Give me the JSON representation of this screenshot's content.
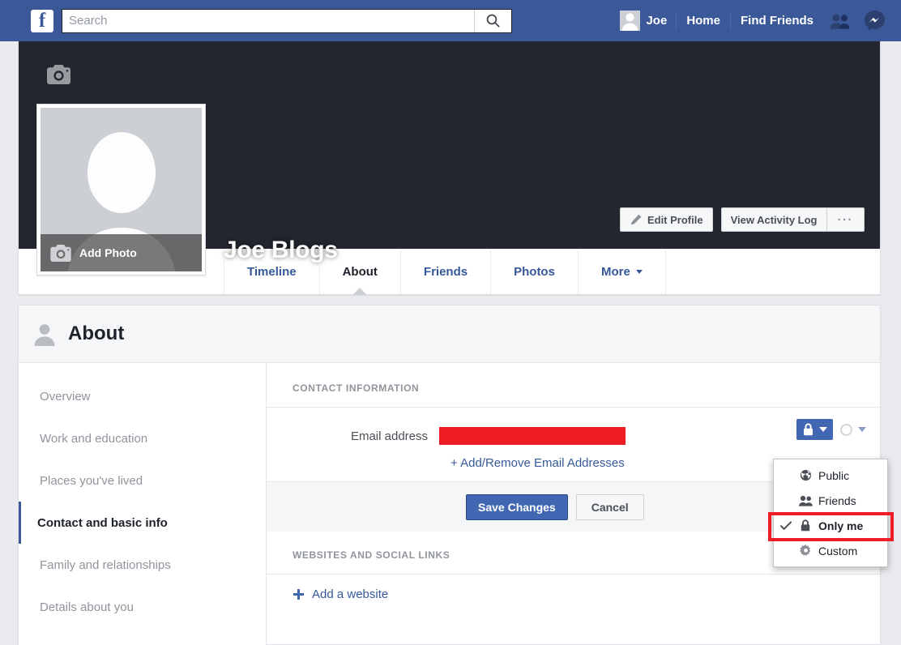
{
  "topnav": {
    "logo_letter": "f",
    "search": {
      "placeholder": "Search",
      "value": ""
    },
    "search_icon": "search-icon",
    "user_name": "Joe",
    "home_label": "Home",
    "find_friends_label": "Find Friends",
    "friend_requests_icon": "friends-icon",
    "messenger_icon": "messenger-icon",
    "bg_color": "#3b5998"
  },
  "profile": {
    "name": "Joe Blogs",
    "cover_camera_icon": "camera-icon",
    "cover_color": "#23262e",
    "add_photo_label": "Add Photo",
    "add_photo_icon": "camera-icon",
    "actions": {
      "edit_profile_label": "Edit Profile",
      "edit_profile_icon": "pencil-icon",
      "view_activity_log_label": "View Activity Log",
      "more_label": "···"
    },
    "tabs": [
      {
        "label": "Timeline",
        "active": false,
        "caret": false
      },
      {
        "label": "About",
        "active": true,
        "caret": false
      },
      {
        "label": "Friends",
        "active": false,
        "caret": false
      },
      {
        "label": "Photos",
        "active": false,
        "caret": false
      },
      {
        "label": "More",
        "active": false,
        "caret": true
      }
    ]
  },
  "about": {
    "header_title": "About",
    "header_icon": "person-icon",
    "sidebar": [
      {
        "label": "Overview",
        "active": false
      },
      {
        "label": "Work and education",
        "active": false
      },
      {
        "label": "Places you've lived",
        "active": false
      },
      {
        "label": "Contact and basic info",
        "active": true
      },
      {
        "label": "Family and relationships",
        "active": false
      },
      {
        "label": "Details about you",
        "active": false
      }
    ],
    "contact_section": {
      "title": "CONTACT INFORMATION",
      "email_label": "Email address",
      "email_value_redacted": true,
      "redaction_color": "#ee1d23",
      "add_remove_link": "+ Add/Remove Email Addresses",
      "privacy_icon": "lock-icon",
      "privacy_button_color": "#4267b2"
    },
    "save_row": {
      "save_label": "Save Changes",
      "cancel_label": "Cancel"
    },
    "websites_section": {
      "title": "WEBSITES AND SOCIAL LINKS",
      "add_website_label": "Add a website",
      "add_icon": "plus-icon"
    }
  },
  "privacy_menu": {
    "items": [
      {
        "label": "Public",
        "icon": "globe-icon",
        "selected": false
      },
      {
        "label": "Friends",
        "icon": "friends-icon",
        "selected": false
      },
      {
        "label": "Only me",
        "icon": "lock-icon",
        "selected": true
      },
      {
        "label": "Custom",
        "icon": "gear-icon",
        "selected": false
      }
    ],
    "highlight_color": "#ee1c25",
    "highlighted_item": "Only me"
  }
}
